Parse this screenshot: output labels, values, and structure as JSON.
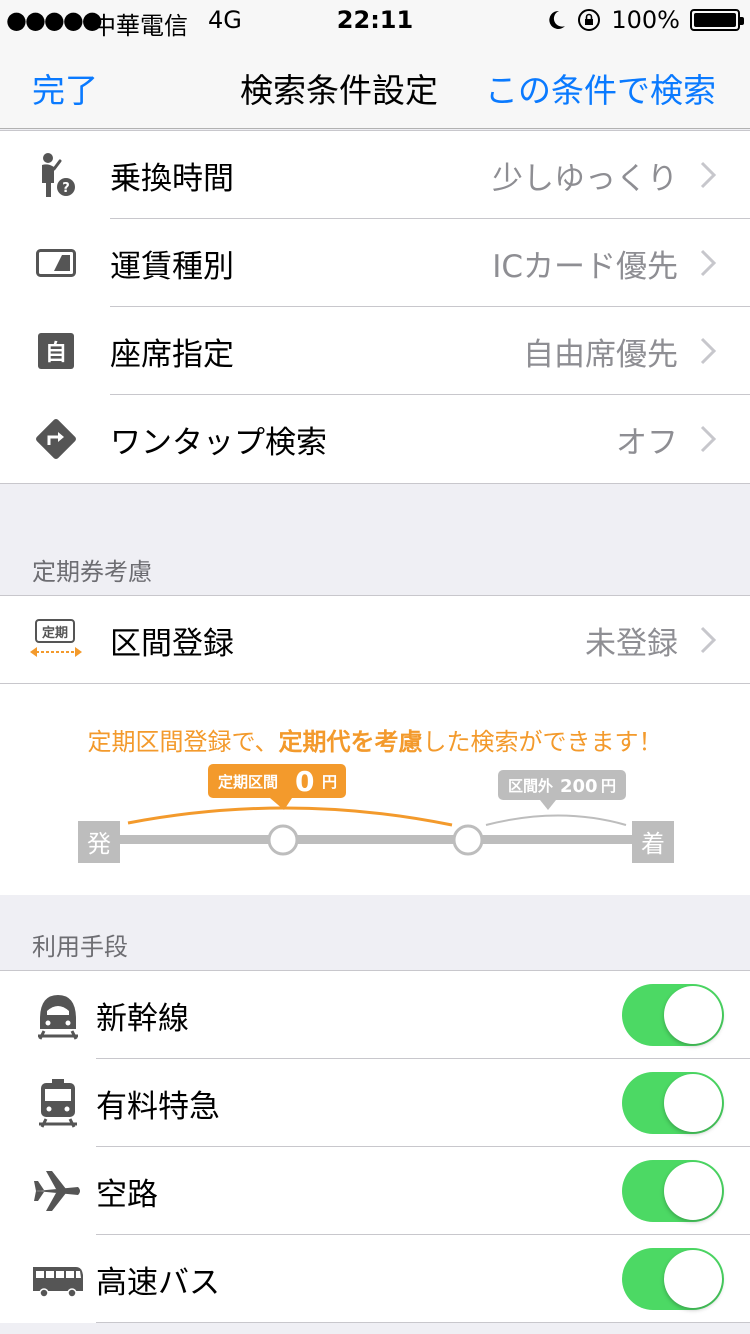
{
  "status_bar": {
    "signal": "●●●●●",
    "carrier": "中華電信",
    "network": "4G",
    "time": "22:11",
    "battery": "100%"
  },
  "nav": {
    "done": "完了",
    "title": "検索条件設定",
    "search_action": "この条件で検索"
  },
  "settings": [
    {
      "label": "乗換時間",
      "value": "少しゆっくり",
      "icon": "person-question-icon"
    },
    {
      "label": "運賃種別",
      "value": "ICカード優先",
      "icon": "ic-card-icon"
    },
    {
      "label": "座席指定",
      "value": "自由席優先",
      "icon": "seat-icon",
      "icon_text": "自"
    },
    {
      "label": "ワンタップ検索",
      "value": "オフ",
      "icon": "turn-sign-icon"
    }
  ],
  "commuter": {
    "header": "定期券考慮",
    "row": {
      "label": "区間登録",
      "value": "未登録",
      "icon_text": "定期"
    },
    "promo": {
      "pre": "定期区間登録で、",
      "emphasis": "定期代を考慮",
      "post": "した検索ができます！"
    },
    "diagram": {
      "pass_label": "定期区間",
      "pass_amount": "0",
      "pass_unit": "円",
      "outside_label": "区間外",
      "outside_amount": "200",
      "outside_unit": "円",
      "depart": "発",
      "arrive": "着"
    }
  },
  "transport": {
    "header": "利用手段",
    "items": [
      {
        "label": "新幹線",
        "icon": "bullet-train-icon",
        "on": true
      },
      {
        "label": "有料特急",
        "icon": "train-icon",
        "on": true
      },
      {
        "label": "空路",
        "icon": "airplane-icon",
        "on": true
      },
      {
        "label": "高速バス",
        "icon": "bus-icon",
        "on": true
      }
    ]
  },
  "colors": {
    "accent": "#0a7aff",
    "orange": "#f39a2c",
    "toggle_on": "#4cd964",
    "secondary_text": "#8e8e93"
  }
}
